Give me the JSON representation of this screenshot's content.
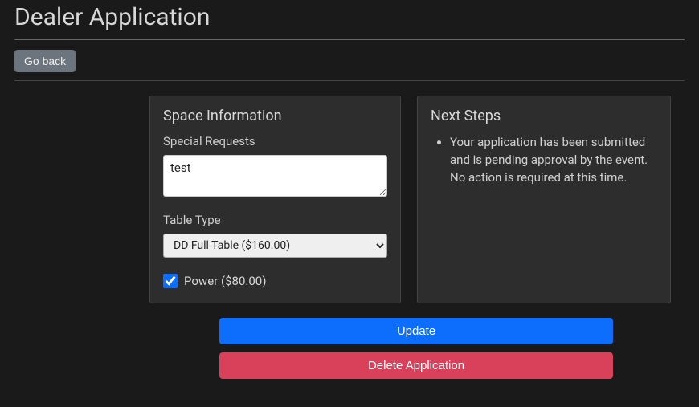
{
  "page_title": "Dealer Application",
  "go_back_label": "Go back",
  "space_info": {
    "heading": "Space Information",
    "special_requests_label": "Special Requests",
    "special_requests_value": "test",
    "table_type_label": "Table Type",
    "table_type_selected": "DD Full Table ($160.00)",
    "power_checked": true,
    "power_label": "Power ($80.00)"
  },
  "next_steps": {
    "heading": "Next Steps",
    "items": [
      "Your application has been submitted and is pending approval by the event. No action is required at this time."
    ]
  },
  "buttons": {
    "update": "Update",
    "delete": "Delete Application"
  }
}
